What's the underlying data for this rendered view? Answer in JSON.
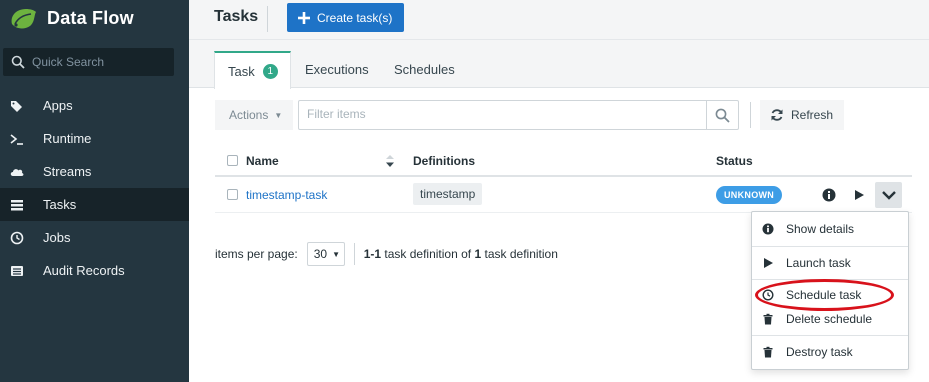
{
  "app": {
    "name": "Data Flow"
  },
  "sidebar": {
    "search_placeholder": "Quick Search",
    "items": [
      {
        "label": "Apps",
        "icon": "tags-icon"
      },
      {
        "label": "Runtime",
        "icon": "terminal-icon"
      },
      {
        "label": "Streams",
        "icon": "cloud-icon"
      },
      {
        "label": "Tasks",
        "icon": "tasks-icon",
        "active": true
      },
      {
        "label": "Jobs",
        "icon": "clock-icon"
      },
      {
        "label": "Audit Records",
        "icon": "list-icon"
      }
    ]
  },
  "header": {
    "title": "Tasks",
    "create_label": "Create task(s)"
  },
  "tabs": [
    {
      "label": "Task",
      "badge": "1",
      "active": true
    },
    {
      "label": "Executions"
    },
    {
      "label": "Schedules"
    }
  ],
  "toolbar": {
    "actions_label": "Actions",
    "filter_placeholder": "Filter items",
    "refresh_label": "Refresh"
  },
  "table": {
    "columns": [
      "Name",
      "Definitions",
      "Status"
    ],
    "rows": [
      {
        "name": "timestamp-task",
        "definition": "timestamp",
        "status": "UNKNOWN"
      }
    ]
  },
  "pager": {
    "items_per_page_label": "items per page:",
    "page_size": "30",
    "range": "1-1",
    "middle": "task definition of",
    "total": "1",
    "end": "task definition"
  },
  "row_menu": {
    "items": [
      {
        "label": "Show details",
        "icon": "info-icon"
      },
      {
        "label": "Launch task",
        "icon": "play-icon"
      },
      {
        "label": "Schedule task",
        "icon": "clock-icon"
      },
      {
        "label": "Delete schedule",
        "icon": "trash-icon"
      },
      {
        "label": "Destroy task",
        "icon": "trash-icon"
      }
    ]
  },
  "colors": {
    "sidebar_bg": "#243640",
    "primary": "#1e73c7",
    "accent_green": "#31a889",
    "status_unknown": "#3d9de6",
    "highlight_ring": "#d8121b"
  }
}
